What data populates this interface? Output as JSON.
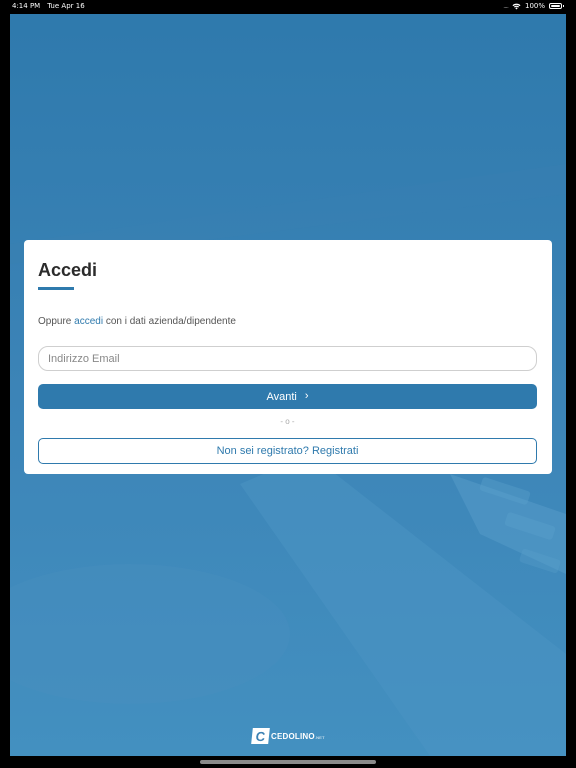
{
  "status_bar": {
    "time": "4:14 PM",
    "date": "Tue Apr 16",
    "signal": "....",
    "battery": "100%"
  },
  "login": {
    "title": "Accedi",
    "subtitle_prefix": "Oppure",
    "subtitle_link": "accedi",
    "subtitle_suffix": "con i dati azienda/dipendente",
    "email_placeholder": "Indirizzo Email",
    "email_value": "",
    "next_label": "Avanti",
    "next_icon": "chevron-right-icon",
    "separator": "- o -",
    "register_label": "Non sei registrato? Registrati"
  },
  "brand": {
    "mark": "C",
    "name": "CEDOLINO",
    "suffix": ".NET"
  },
  "colors": {
    "accent": "#2f7aad",
    "background": "#3d82b4",
    "card": "#ffffff"
  }
}
